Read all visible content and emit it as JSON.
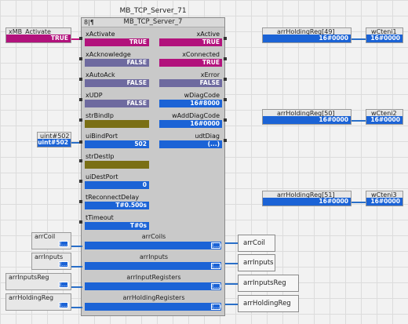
{
  "block": {
    "instance_name": "MB_TCP_Server_71",
    "type_name": "MB_TCP_Server_7",
    "id_label": "8|¶"
  },
  "inputs": [
    {
      "name": "xActivate",
      "value": "TRUE"
    },
    {
      "name": "xAcknowledge",
      "value": "FALSE"
    },
    {
      "name": "xAutoAck",
      "value": "FALSE"
    },
    {
      "name": "xUDP",
      "value": "FALSE"
    },
    {
      "name": "strBindIp",
      "value": ""
    },
    {
      "name": "uiBindPort",
      "value": "502"
    },
    {
      "name": "strDestIp",
      "value": ""
    },
    {
      "name": "uiDestPort",
      "value": "0"
    },
    {
      "name": "tReconnectDelay",
      "value": "T#0.500s"
    },
    {
      "name": "tTimeout",
      "value": "T#0s"
    }
  ],
  "outputs": [
    {
      "name": "xActive",
      "value": "TRUE"
    },
    {
      "name": "xConnected",
      "value": "TRUE"
    },
    {
      "name": "xError",
      "value": "FALSE"
    },
    {
      "name": "wDiagCode",
      "value": "16#8000"
    },
    {
      "name": "wAddDiagCode",
      "value": "16#0000"
    },
    {
      "name": "udtDiag",
      "value": "(...)"
    }
  ],
  "inouts": [
    {
      "name": "arrCoils",
      "value": "(...)"
    },
    {
      "name": "arrInputs",
      "value": "(...)"
    },
    {
      "name": "arrInputRegisters",
      "value": "(...)"
    },
    {
      "name": "arrHoldingRegisters",
      "value": "(...)"
    }
  ],
  "external_inputs": {
    "activate": {
      "name": "xMB_Activate",
      "value": "TRUE"
    },
    "bind_port": {
      "name": "uint#502",
      "value": "uint#502"
    },
    "coil": {
      "name": "arrCoil",
      "value": "(...)"
    },
    "inputs": {
      "name": "arrInputs",
      "value": "(...)"
    },
    "input_reg": {
      "name": "arrInputsReg",
      "value": "(...)"
    },
    "holding_reg": {
      "name": "arrHoldingReg",
      "value": "(...)"
    }
  },
  "inout_outputs": [
    "arrCoil",
    "arrInputs",
    "arrInputsReg",
    "arrHoldingReg"
  ],
  "holding_regs": [
    {
      "name": "arrHoldingReg[49]",
      "value": "16#0000",
      "target": "wCteni1",
      "target_value": "16#0000"
    },
    {
      "name": "arrHoldingReg[50]",
      "value": "16#0000",
      "target": "wCteni2",
      "target_value": "16#0000"
    },
    {
      "name": "arrHoldingReg[51]",
      "value": "16#0000",
      "target": "wCteni3",
      "target_value": "16#0000"
    }
  ]
}
